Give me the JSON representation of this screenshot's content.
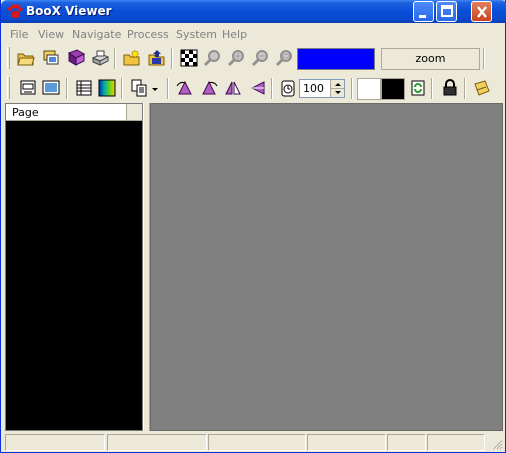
{
  "window": {
    "title": "BooX Viewer",
    "app_icon": "paw-icon"
  },
  "menubar": {
    "items": [
      "File",
      "View",
      "Navigate",
      "Process",
      "System",
      "Help"
    ]
  },
  "toolbar1": {
    "icons": [
      "open-folder-icon",
      "export-pages-icon",
      "book-icon",
      "print-icon",
      "new-folder-icon",
      "save-folder-icon",
      "checker-icon",
      "zoom-icon",
      "zoom-in-icon",
      "zoom-out-icon",
      "zoom-fit-icon"
    ],
    "color_swatch": "#0000ff",
    "zoom_label": "zoom"
  },
  "toolbar2": {
    "icons": [
      "page-view-icon",
      "fullscreen-icon",
      "grid-icon",
      "gradient-icon",
      "copy-icon",
      "rotate-left-icon",
      "rotate-right-icon",
      "flip-horizontal-icon",
      "flip-vertical-icon",
      "timer-icon",
      "refresh-icon",
      "lock-icon",
      "note-icon"
    ],
    "timer_value": "100",
    "fg_swatch": "#ffffff",
    "bg_swatch": "#000000"
  },
  "page_list": {
    "column_header": "Page"
  },
  "statusbar": {
    "cells": [
      "",
      "",
      "",
      "",
      "",
      "",
      ""
    ]
  }
}
